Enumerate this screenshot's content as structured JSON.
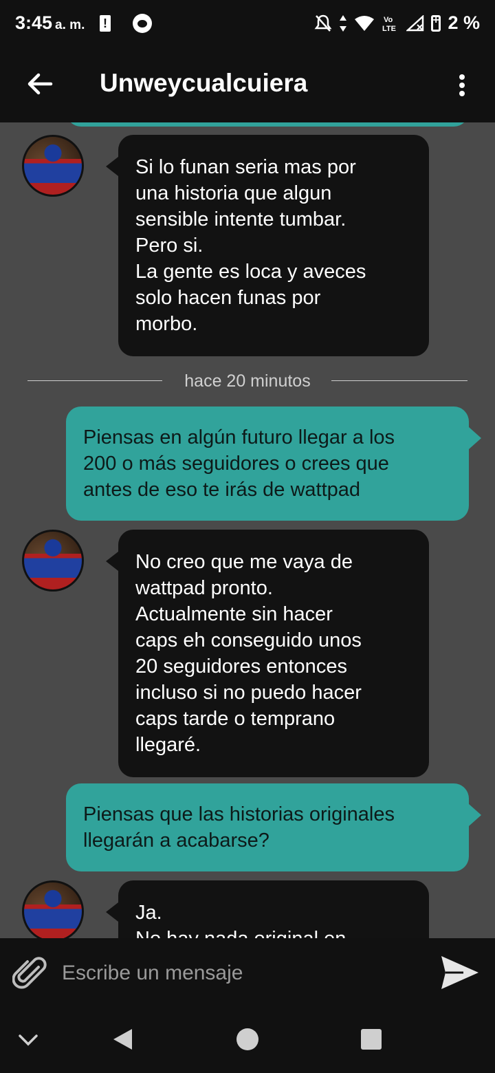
{
  "status_bar": {
    "time": "3:45",
    "ampm": "a. m.",
    "battery_text": "2 %"
  },
  "header": {
    "title": "Unweycualcuiera"
  },
  "messages": [
    {
      "direction": "incoming",
      "text": "Si lo funan seria mas por\nuna historia que algun\nsensible intente tumbar.\nPero si.\nLa gente es loca y aveces\nsolo hacen funas por\nmorbo."
    },
    {
      "direction": "divider",
      "text": "hace 20 minutos"
    },
    {
      "direction": "outgoing",
      "text": "Piensas en algún futuro llegar a los\n200 o más seguidores o crees que\nantes de eso te irás de wattpad"
    },
    {
      "direction": "incoming",
      "text": "No creo que me vaya de\nwattpad pronto.\nActualmente sin hacer\ncaps eh conseguido unos\n20 seguidores entonces\nincluso si no puedo hacer\ncaps tarde o temprano\nllegaré."
    },
    {
      "direction": "outgoing",
      "text": "Piensas que las historias originales\nllegarán a acabarse?"
    },
    {
      "direction": "incoming",
      "text": "Ja.\nNo hay nada original en"
    }
  ],
  "composer": {
    "placeholder": "Escribe un mensaje"
  },
  "colors": {
    "outgoing_bubble": "#31a39b",
    "incoming_bubble": "#121212",
    "background": "#4a4a4a",
    "bars": "#111111"
  }
}
